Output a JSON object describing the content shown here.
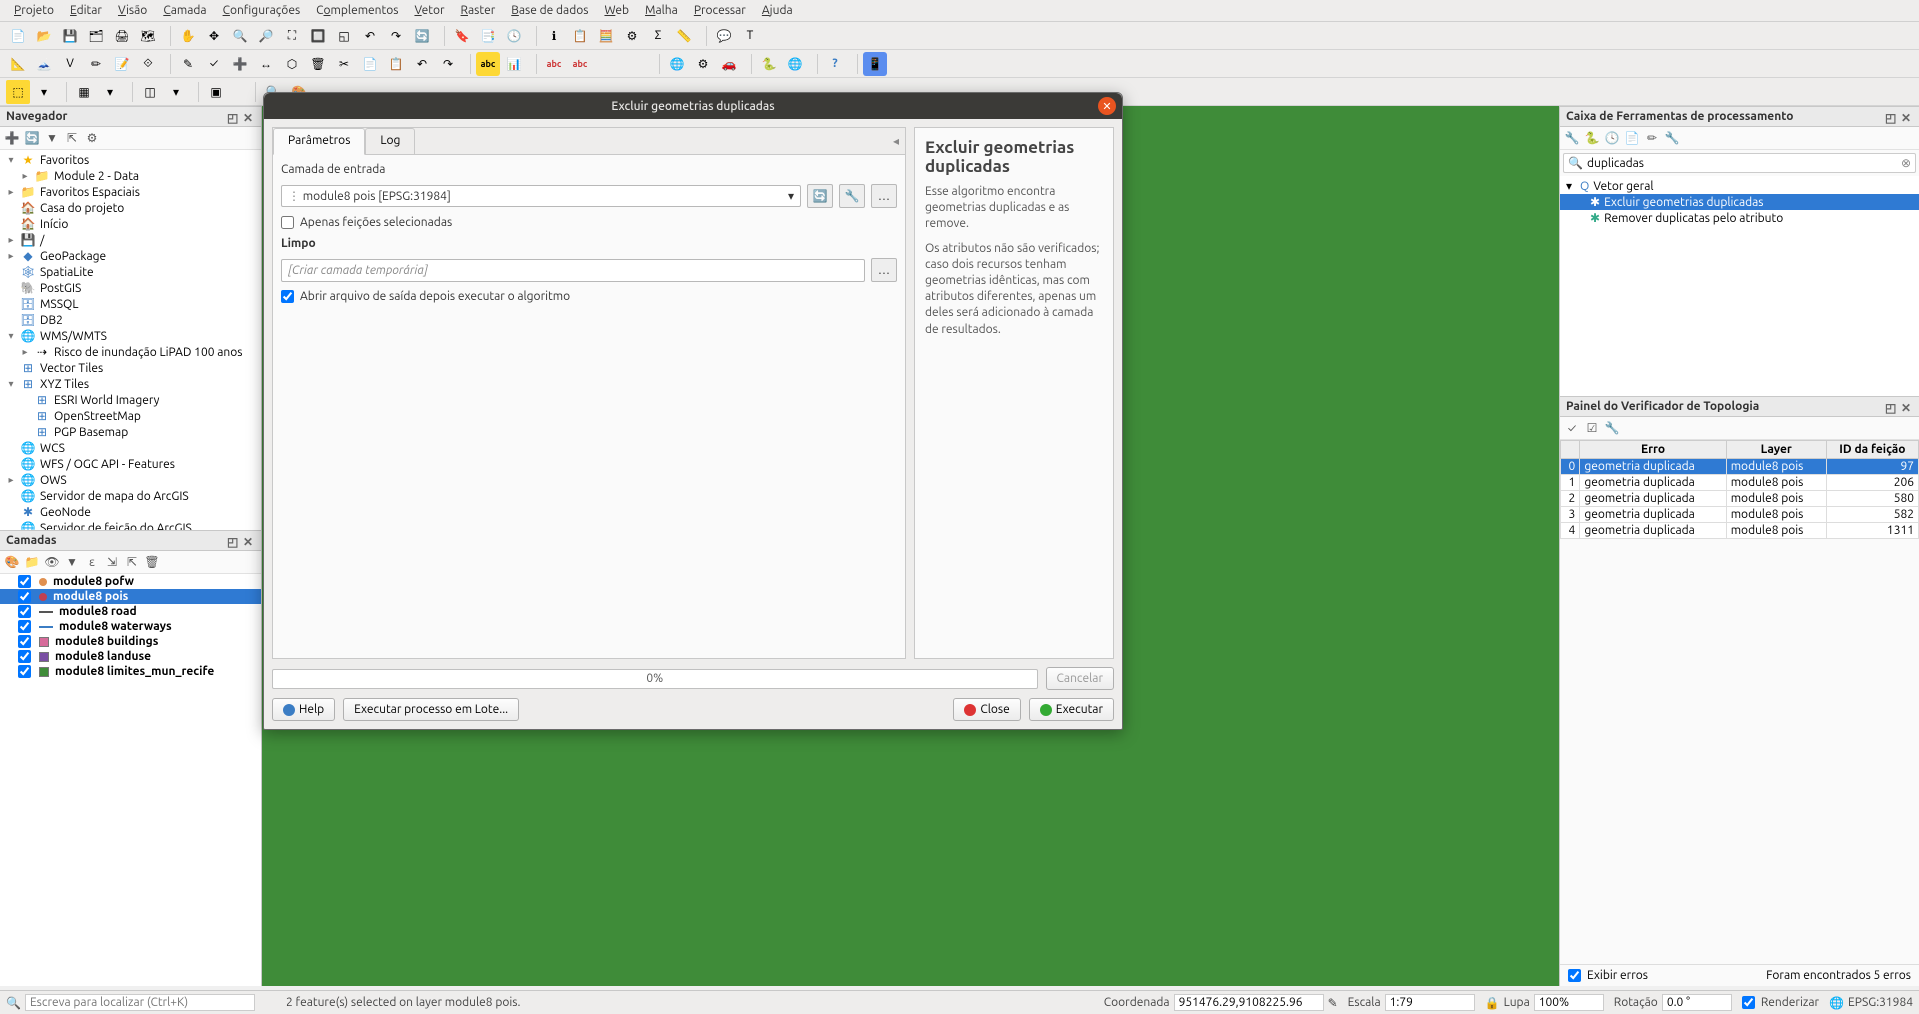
{
  "menubar": [
    "Projeto",
    "Editar",
    "Visão",
    "Camada",
    "Configurações",
    "Complementos",
    "Vetor",
    "Raster",
    "Base de dados",
    "Web",
    "Malha",
    "Processar",
    "Ajuda"
  ],
  "browser": {
    "title": "Navegador",
    "items": [
      {
        "exp": "▾",
        "icon": "★",
        "cls": "favstar",
        "label": "Favoritos"
      },
      {
        "exp": "▸",
        "icon": "📁",
        "cls": "fldr indent1",
        "label": "Module 2 - Data"
      },
      {
        "exp": "▸",
        "icon": "📁",
        "cls": "fldr",
        "label": "Favoritos Espaciais"
      },
      {
        "exp": "",
        "icon": "🏠",
        "cls": "",
        "label": "Casa do projeto"
      },
      {
        "exp": "",
        "icon": "🏠",
        "cls": "",
        "label": "Início"
      },
      {
        "exp": "▸",
        "icon": "💾",
        "cls": "",
        "label": "/"
      },
      {
        "exp": "▸",
        "icon": "◆",
        "cls": "db",
        "label": "GeoPackage"
      },
      {
        "exp": "",
        "icon": "🕸",
        "cls": "db",
        "label": "SpatiaLite"
      },
      {
        "exp": "",
        "icon": "🐘",
        "cls": "db",
        "label": "PostGIS"
      },
      {
        "exp": "",
        "icon": "🗄",
        "cls": "db",
        "label": "MSSQL"
      },
      {
        "exp": "",
        "icon": "🗄",
        "cls": "db",
        "label": "DB2"
      },
      {
        "exp": "▾",
        "icon": "🌐",
        "cls": "glb",
        "label": "WMS/WMTS"
      },
      {
        "exp": "▸",
        "icon": "⇢",
        "cls": "indent1",
        "label": "Risco de inundação LiPAD 100 anos"
      },
      {
        "exp": "",
        "icon": "⊞",
        "cls": "db",
        "label": "Vector Tiles"
      },
      {
        "exp": "▾",
        "icon": "⊞",
        "cls": "db",
        "label": "XYZ Tiles"
      },
      {
        "exp": "",
        "icon": "⊞",
        "cls": "db indent1",
        "label": "ESRI World Imagery"
      },
      {
        "exp": "",
        "icon": "⊞",
        "cls": "db indent1",
        "label": "OpenStreetMap"
      },
      {
        "exp": "",
        "icon": "⊞",
        "cls": "db indent1",
        "label": "PGP Basemap"
      },
      {
        "exp": "",
        "icon": "🌐",
        "cls": "glb",
        "label": "WCS"
      },
      {
        "exp": "",
        "icon": "🌐",
        "cls": "glb",
        "label": "WFS / OGC API - Features"
      },
      {
        "exp": "▸",
        "icon": "🌐",
        "cls": "glb",
        "label": "OWS"
      },
      {
        "exp": "",
        "icon": "🌐",
        "cls": "glb",
        "label": "Servidor de mapa do ArcGIS"
      },
      {
        "exp": "",
        "icon": "✱",
        "cls": "db",
        "label": "GeoNode"
      },
      {
        "exp": "",
        "icon": "🌐",
        "cls": "glb",
        "label": "Servidor de feição do ArcGIS"
      }
    ]
  },
  "layers": {
    "title": "Camadas",
    "items": [
      {
        "checked": true,
        "color": "#e09050",
        "label": "module8 pofw",
        "selected": false,
        "shape": "dot"
      },
      {
        "checked": true,
        "color": "#c04050",
        "label": "module8 pois",
        "selected": true,
        "shape": "dot"
      },
      {
        "checked": true,
        "color": "#555555",
        "label": "module8 road",
        "selected": false,
        "shape": "line"
      },
      {
        "checked": true,
        "color": "#3b7dc4",
        "label": "module8 waterways",
        "selected": false,
        "shape": "line"
      },
      {
        "checked": true,
        "color": "#d66b9a",
        "label": "module8 buildings",
        "selected": false,
        "shape": "box"
      },
      {
        "checked": true,
        "color": "#7a4fa3",
        "label": "module8 landuse",
        "selected": false,
        "shape": "box"
      },
      {
        "checked": true,
        "color": "#3f8c39",
        "label": "module8 limites_mun_recife",
        "selected": false,
        "shape": "box"
      }
    ]
  },
  "toolbox": {
    "title": "Caixa de Ferramentas de processamento",
    "search": "duplicadas",
    "group": "Vetor geral",
    "items": [
      {
        "label": "Excluir geometrias duplicadas",
        "selected": true
      },
      {
        "label": "Remover duplicatas pelo atributo",
        "selected": false
      }
    ]
  },
  "topology": {
    "title": "Painel do Verificador de Topologia",
    "headers": [
      "",
      "Erro",
      "Layer",
      "ID da feição"
    ],
    "rows": [
      {
        "n": 0,
        "err": "geometria duplicada",
        "layer": "module8 pois",
        "id": 97,
        "selected": true
      },
      {
        "n": 1,
        "err": "geometria duplicada",
        "layer": "module8 pois",
        "id": 206,
        "selected": false
      },
      {
        "n": 2,
        "err": "geometria duplicada",
        "layer": "module8 pois",
        "id": 580,
        "selected": false
      },
      {
        "n": 3,
        "err": "geometria duplicada",
        "layer": "module8 pois",
        "id": 582,
        "selected": false
      },
      {
        "n": 4,
        "err": "geometria duplicada",
        "layer": "module8 pois",
        "id": 1311,
        "selected": false
      }
    ],
    "show_errors": "Exibir erros",
    "summary": "Foram encontrados 5 erros"
  },
  "dialog": {
    "title": "Excluir geometrias duplicadas",
    "tabs": [
      "Parâmetros",
      "Log"
    ],
    "input_label": "Camada de entrada",
    "input_value": "module8 pois [EPSG:31984]",
    "only_selected": "Apenas feições selecionadas",
    "clean_label": "Limpo",
    "clean_placeholder": "[Criar camada temporária]",
    "open_after": "Abrir arquivo de saída depois executar o algoritmo",
    "desc_title": "Excluir geometrias duplicadas",
    "desc1": "Esse algoritmo encontra geometrias duplicadas e as remove.",
    "desc2": "Os atributos não são verificados; caso dois recursos tenham geometrias idênticas, mas com atributos diferentes, apenas um deles será adicionado à camada de resultados.",
    "progress": "0%",
    "cancel": "Cancelar",
    "help": "Help",
    "batch": "Executar processo em Lote...",
    "close": "Close",
    "run": "Executar"
  },
  "status": {
    "locator_placeholder": "Escreva para localizar (Ctrl+K)",
    "selection": "2 feature(s) selected on layer module8 pois.",
    "coord_label": "Coordenada",
    "coord": "951476.29,9108225.96",
    "scale_label": "Escala",
    "scale": "1:79",
    "mag_label": "Lupa",
    "mag": "100%",
    "rot_label": "Rotação",
    "rot": "0.0 °",
    "render": "Renderizar",
    "crs": "EPSG:31984"
  }
}
